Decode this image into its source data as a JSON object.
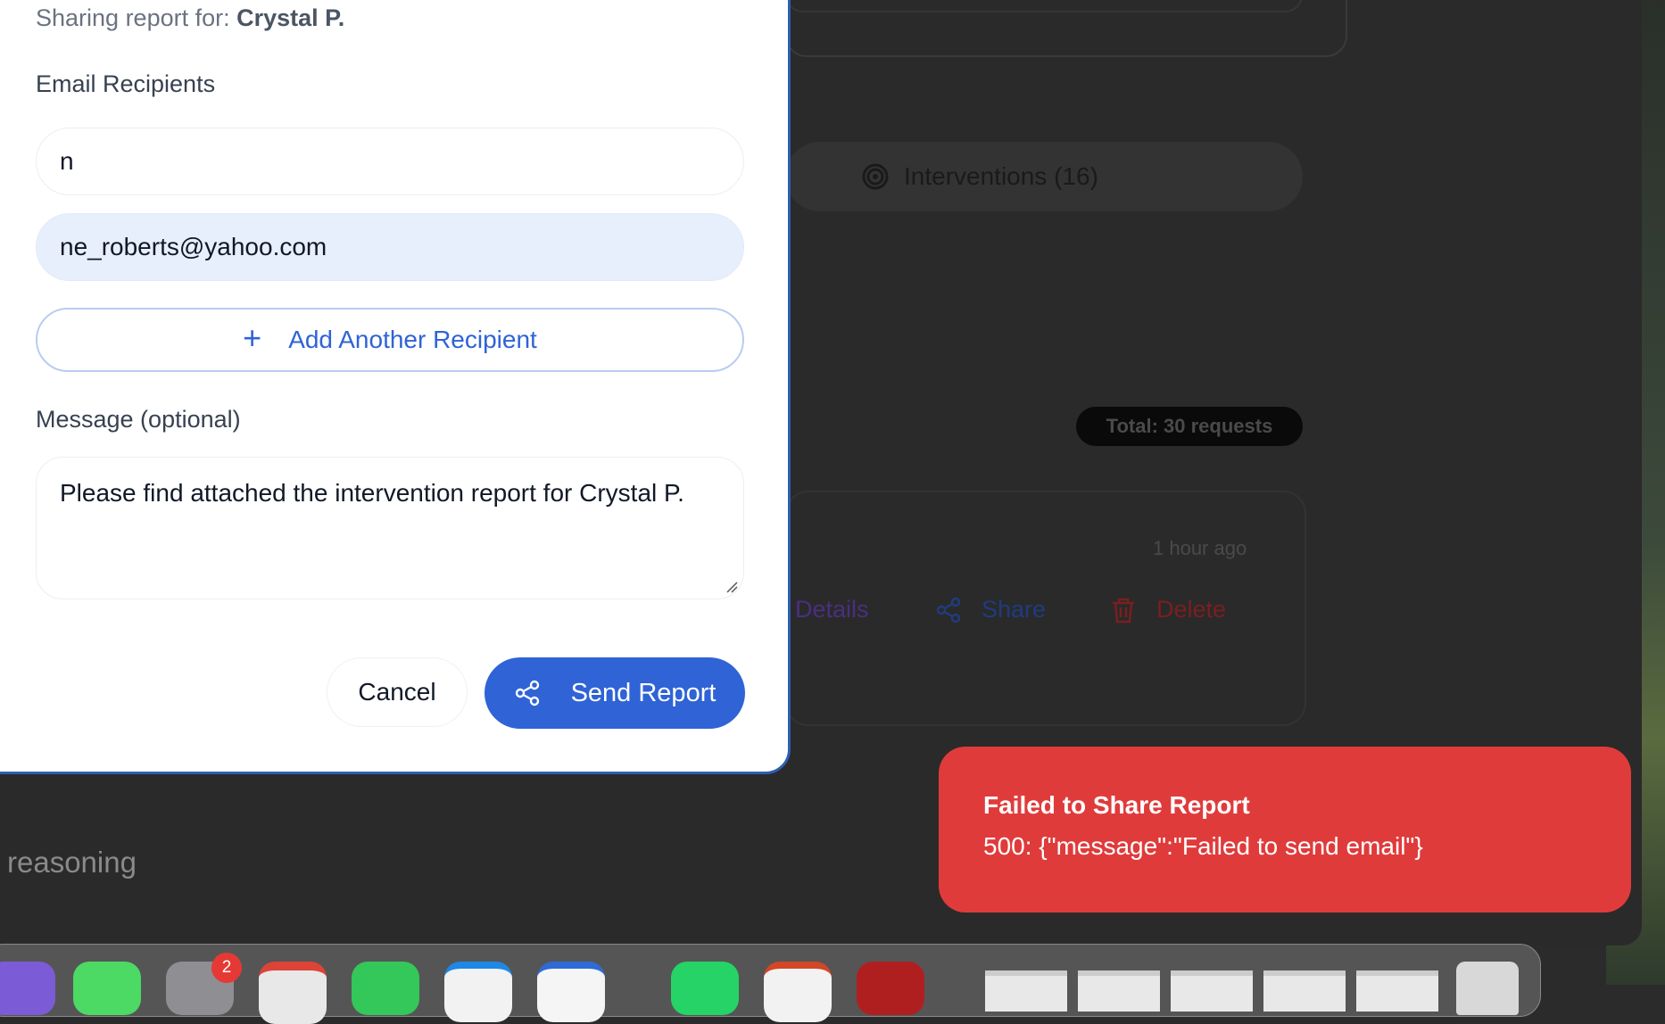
{
  "modal": {
    "sharing_prefix": "Sharing report for: ",
    "patient_name": "Crystal P.",
    "email_label": "Email Recipients",
    "recipients": [
      "n",
      "ne_roberts@yahoo.com"
    ],
    "add_recipient_label": "Add Another Recipient",
    "message_label": "Message (optional)",
    "message_value": "Please find attached the intervention report for Crystal P.",
    "cancel_label": "Cancel",
    "send_label": "Send Report"
  },
  "background": {
    "tab_label": "Interventions (16)",
    "total_badge": "Total: 30 requests",
    "time_ago": "1 hour ago",
    "actions": {
      "details": "Details",
      "share": "Share",
      "delete": "Delete"
    },
    "reasoning_text": "reasoning"
  },
  "toast": {
    "title": "Failed to Share Report",
    "message": "500: {\"message\":\"Failed to send email\"}"
  },
  "dock": {
    "badge_count": "2"
  },
  "colors": {
    "accent": "#2f63d6",
    "error": "#e03b3b"
  }
}
